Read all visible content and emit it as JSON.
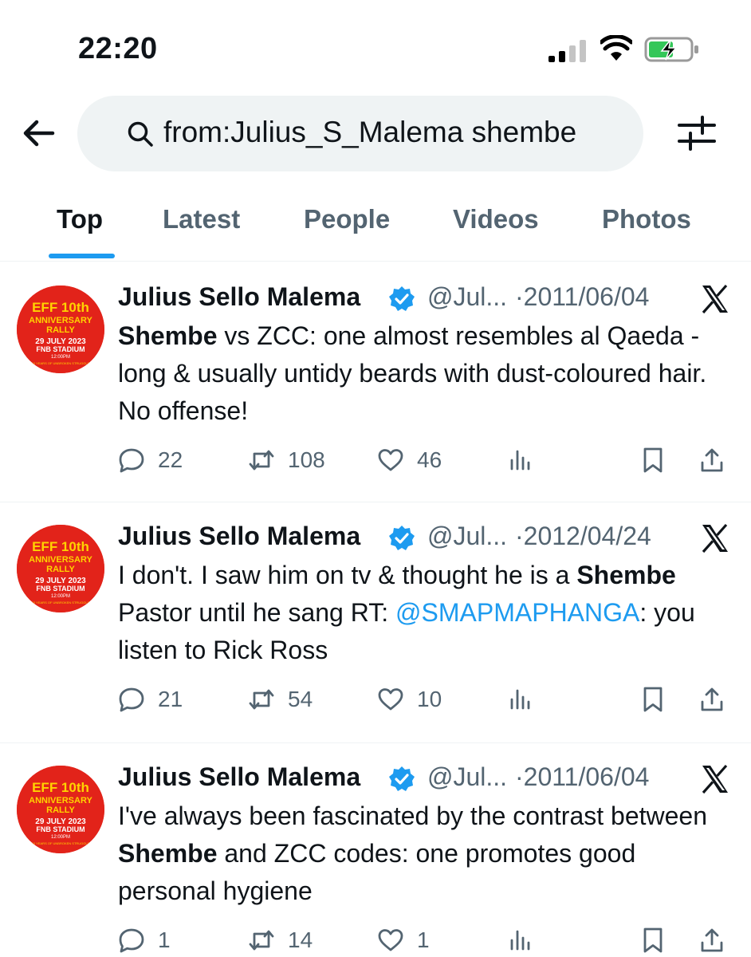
{
  "status_bar": {
    "time": "22:20",
    "icons": [
      "signal-icon",
      "wifi-icon",
      "battery-charging-icon"
    ],
    "battery_color": "#34c759"
  },
  "search": {
    "query": "from:Julius_S_Malema shembe",
    "icons": [
      "back-arrow-icon",
      "search-icon",
      "filter-sliders-icon"
    ]
  },
  "tabs": [
    {
      "label": "Top",
      "active": true
    },
    {
      "label": "Latest",
      "active": false
    },
    {
      "label": "People",
      "active": false
    },
    {
      "label": "Videos",
      "active": false
    },
    {
      "label": "Photos",
      "active": false
    }
  ],
  "colors": {
    "accent": "#1d9bf0",
    "text": "#0f1419",
    "secondary": "#536471",
    "avatar_red": "#e2231a",
    "avatar_yellow": "#ffd200"
  },
  "avatar": {
    "line1": "EFF 10th",
    "line2": "ANNIVERSARY",
    "line3": "RALLY",
    "line4": "29 JULY 2023",
    "line5": "FNB STADIUM",
    "line6": "12:00PM",
    "line7": "10 YEARS OF UNBROKEN STRUGGLE"
  },
  "tweets": [
    {
      "name": "Julius Sello Malema",
      "handle": "@Jul...",
      "date": "·2011/06/04",
      "text_bold": "Shembe",
      "text_rest": " vs ZCC: one almost resembles al Qaeda - long & usually untidy beards with dust-coloured hair. No offense!",
      "replies": "22",
      "retweets": "108",
      "likes": "46"
    },
    {
      "name": "Julius Sello Malema",
      "handle": "@Jul...",
      "date": "·2012/04/24",
      "text_pre": "I don't. I saw him on tv & thought he is a ",
      "text_bold": "Shembe",
      "text_mid": " Pastor until he sang RT: ",
      "mention": "@SMAPMAPHANGA",
      "text_post": ":  you listen to Rick Ross",
      "replies": "21",
      "retweets": "54",
      "likes": "10"
    },
    {
      "name": "Julius Sello Malema",
      "handle": "@Jul...",
      "date": "·2011/06/04",
      "text_pre": "I've always been fascinated by the contrast between ",
      "text_bold": "Shembe",
      "text_post": " and ZCC codes: one promotes good personal hygiene",
      "replies": "1",
      "retweets": "14",
      "likes": "1"
    }
  ]
}
